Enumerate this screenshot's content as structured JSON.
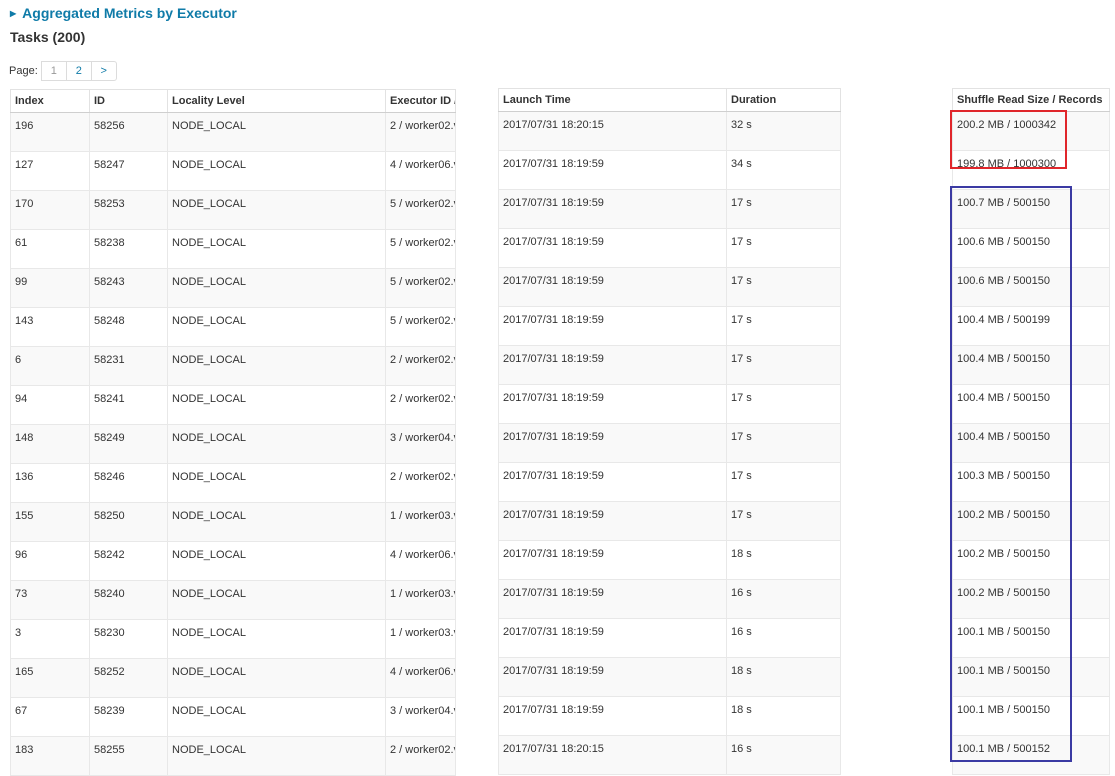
{
  "aggregated_link": "Aggregated Metrics by Executor",
  "tasks_title": "Tasks (200)",
  "pagination": {
    "label": "Page:",
    "pages": [
      "1",
      "2"
    ],
    "next": ">",
    "current": "1"
  },
  "columns": {
    "index": "Index",
    "id": "ID",
    "locality": "Locality Level",
    "executor": "Executor ID / Host",
    "launch": "Launch Time",
    "duration": "Duration",
    "shuffle": "Shuffle Read Size / Records"
  },
  "rows": [
    {
      "index": "196",
      "id": "58256",
      "locality": "NODE_LOCAL",
      "executor": "2 / worker02.v",
      "launch": "2017/07/31 18:20:15",
      "duration": "32 s",
      "shuffle": "200.2 MB / 1000342"
    },
    {
      "index": "127",
      "id": "58247",
      "locality": "NODE_LOCAL",
      "executor": "4 / worker06.v",
      "launch": "2017/07/31 18:19:59",
      "duration": "34 s",
      "shuffle": "199.8 MB / 1000300"
    },
    {
      "index": "170",
      "id": "58253",
      "locality": "NODE_LOCAL",
      "executor": "5 / worker02.v",
      "launch": "2017/07/31 18:19:59",
      "duration": "17 s",
      "shuffle": "100.7 MB / 500150"
    },
    {
      "index": "61",
      "id": "58238",
      "locality": "NODE_LOCAL",
      "executor": "5 / worker02.v",
      "launch": "2017/07/31 18:19:59",
      "duration": "17 s",
      "shuffle": "100.6 MB / 500150"
    },
    {
      "index": "99",
      "id": "58243",
      "locality": "NODE_LOCAL",
      "executor": "5 / worker02.v",
      "launch": "2017/07/31 18:19:59",
      "duration": "17 s",
      "shuffle": "100.6 MB / 500150"
    },
    {
      "index": "143",
      "id": "58248",
      "locality": "NODE_LOCAL",
      "executor": "5 / worker02.v",
      "launch": "2017/07/31 18:19:59",
      "duration": "17 s",
      "shuffle": "100.4 MB / 500199"
    },
    {
      "index": "6",
      "id": "58231",
      "locality": "NODE_LOCAL",
      "executor": "2 / worker02.v",
      "launch": "2017/07/31 18:19:59",
      "duration": "17 s",
      "shuffle": "100.4 MB / 500150"
    },
    {
      "index": "94",
      "id": "58241",
      "locality": "NODE_LOCAL",
      "executor": "2 / worker02.v",
      "launch": "2017/07/31 18:19:59",
      "duration": "17 s",
      "shuffle": "100.4 MB / 500150"
    },
    {
      "index": "148",
      "id": "58249",
      "locality": "NODE_LOCAL",
      "executor": "3 / worker04.v",
      "launch": "2017/07/31 18:19:59",
      "duration": "17 s",
      "shuffle": "100.4 MB / 500150"
    },
    {
      "index": "136",
      "id": "58246",
      "locality": "NODE_LOCAL",
      "executor": "2 / worker02.v",
      "launch": "2017/07/31 18:19:59",
      "duration": "17 s",
      "shuffle": "100.3 MB / 500150"
    },
    {
      "index": "155",
      "id": "58250",
      "locality": "NODE_LOCAL",
      "executor": "1 / worker03.v",
      "launch": "2017/07/31 18:19:59",
      "duration": "17 s",
      "shuffle": "100.2 MB / 500150"
    },
    {
      "index": "96",
      "id": "58242",
      "locality": "NODE_LOCAL",
      "executor": "4 / worker06.v",
      "launch": "2017/07/31 18:19:59",
      "duration": "18 s",
      "shuffle": "100.2 MB / 500150"
    },
    {
      "index": "73",
      "id": "58240",
      "locality": "NODE_LOCAL",
      "executor": "1 / worker03.v",
      "launch": "2017/07/31 18:19:59",
      "duration": "16 s",
      "shuffle": "100.2 MB / 500150"
    },
    {
      "index": "3",
      "id": "58230",
      "locality": "NODE_LOCAL",
      "executor": "1 / worker03.v",
      "launch": "2017/07/31 18:19:59",
      "duration": "16 s",
      "shuffle": "100.1 MB / 500150"
    },
    {
      "index": "165",
      "id": "58252",
      "locality": "NODE_LOCAL",
      "executor": "4 / worker06.v",
      "launch": "2017/07/31 18:19:59",
      "duration": "18 s",
      "shuffle": "100.1 MB / 500150"
    },
    {
      "index": "67",
      "id": "58239",
      "locality": "NODE_LOCAL",
      "executor": "3 / worker04.v",
      "launch": "2017/07/31 18:19:59",
      "duration": "18 s",
      "shuffle": "100.1 MB / 500150"
    },
    {
      "index": "183",
      "id": "58255",
      "locality": "NODE_LOCAL",
      "executor": "2 / worker02.v",
      "launch": "2017/07/31 18:20:15",
      "duration": "16 s",
      "shuffle": "100.1 MB / 500152"
    }
  ],
  "highlight_colors": {
    "red_box": "#e0262b",
    "blue_box": "#3b3aa3"
  },
  "link_color": "#0f7ba8"
}
